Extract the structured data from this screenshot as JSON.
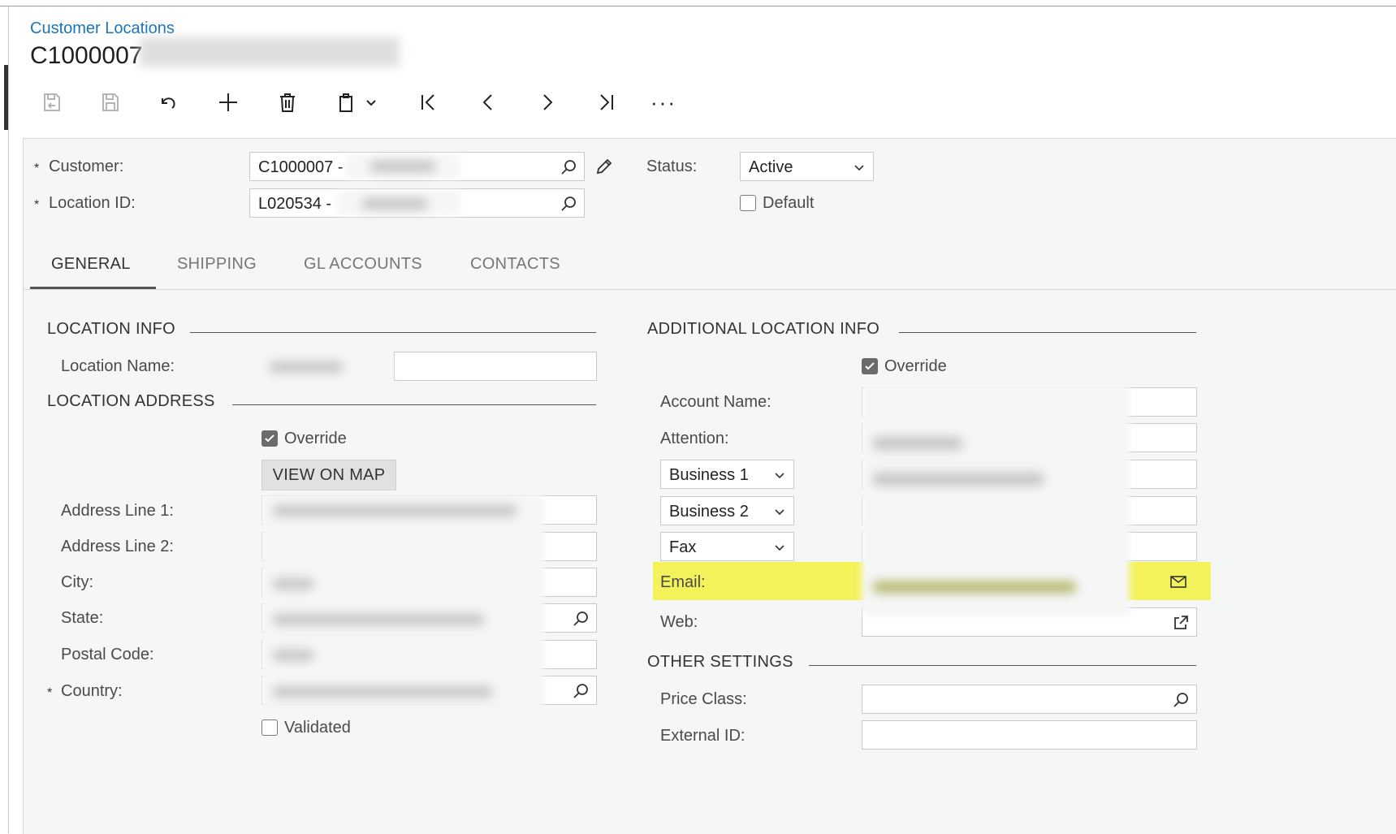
{
  "header": {
    "breadcrumb": "Customer Locations",
    "title": "C1000007"
  },
  "toolbar": {
    "icons": [
      "save-close-icon",
      "save-icon",
      "undo-icon",
      "add-icon",
      "delete-icon",
      "copy-paste-icon",
      "first-record-icon",
      "previous-record-icon",
      "next-record-icon",
      "last-record-icon",
      "more-icon"
    ],
    "more_label": "···"
  },
  "summary": {
    "customer_label": "Customer:",
    "customer_value": "C1000007 -",
    "location_label": "Location ID:",
    "location_value": "L020534 -",
    "status_label": "Status:",
    "status_value": "Active",
    "default_label": "Default"
  },
  "tabs": [
    {
      "label": "GENERAL"
    },
    {
      "label": "SHIPPING"
    },
    {
      "label": "GL ACCOUNTS"
    },
    {
      "label": "CONTACTS"
    }
  ],
  "general": {
    "location_info_title": "LOCATION INFO",
    "location_name_label": "Location Name:",
    "location_address_title": "LOCATION ADDRESS",
    "override_label": "Override",
    "view_on_map": "VIEW ON MAP",
    "address_line1_label": "Address Line 1:",
    "address_line2_label": "Address Line 2:",
    "city_label": "City:",
    "state_label": "State:",
    "postal_code_label": "Postal Code:",
    "country_label": "Country:",
    "validated_label": "Validated",
    "additional_title": "ADDITIONAL LOCATION INFO",
    "additional_override_label": "Override",
    "account_name_label": "Account Name:",
    "attention_label": "Attention:",
    "phone1_type": "Business 1",
    "phone2_type": "Business 2",
    "fax_type": "Fax",
    "email_label": "Email:",
    "web_label": "Web:",
    "other_settings_title": "OTHER SETTINGS",
    "price_class_label": "Price Class:",
    "external_id_label": "External ID:"
  }
}
